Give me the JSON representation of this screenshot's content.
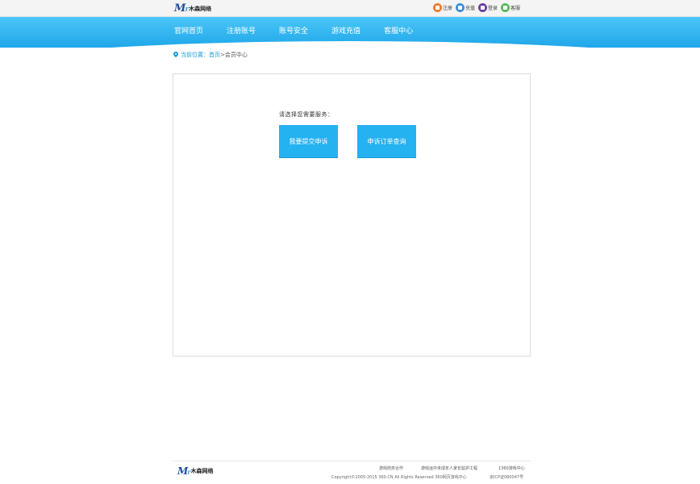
{
  "header": {
    "logo_text": "木森网络",
    "links": [
      {
        "label": "注册",
        "icon": "register-icon",
        "color": "#f07a2b"
      },
      {
        "label": "充值",
        "icon": "recharge-icon",
        "color": "#3b8fd6"
      },
      {
        "label": "登录",
        "icon": "login-icon",
        "color": "#6b3fa0"
      },
      {
        "label": "客服",
        "icon": "service-icon",
        "color": "#5cb85c"
      }
    ]
  },
  "nav": {
    "items": [
      "官网首页",
      "注册账号",
      "账号安全",
      "游戏充值",
      "客服中心"
    ]
  },
  "breadcrumb": {
    "prefix": "当前位置：",
    "home": "首页",
    "separator": ">",
    "current": "会员中心"
  },
  "main": {
    "prompt": "请选择您需要服务：",
    "buttons": {
      "submit_appeal": "我要提交申诉",
      "query_appeal": "申诉订单查询"
    },
    "accent_color": "#24b2f1"
  },
  "footer": {
    "logo_text": "木森网络",
    "links": [
      "游戏商务合作",
      "游戏运中未成年人家长监护工程",
      "1360游戏中心"
    ],
    "copyright": "Copyright©2005-2015 360.CN All Rights Reserved 360网页游戏中心",
    "icp": "京ICP证080047号"
  }
}
